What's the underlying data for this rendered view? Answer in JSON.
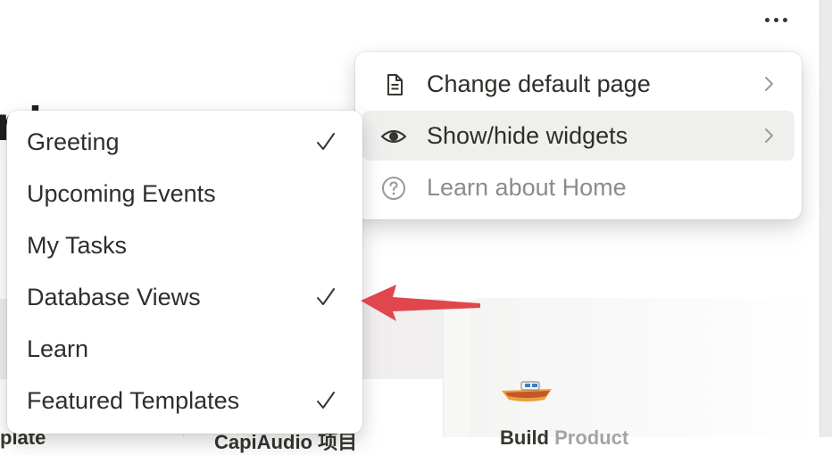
{
  "header": {
    "more_icon": "more-horizontal-icon"
  },
  "background": {
    "heading_fragment": "r             l",
    "card_texts": [
      "plate",
      "CapiAudio 项目",
      "Build ",
      "Product"
    ]
  },
  "home_menu": {
    "items": [
      {
        "label": "Change default page",
        "icon": "file-icon",
        "has_submenu": true
      },
      {
        "label": "Show/hide widgets",
        "icon": "eye-icon",
        "has_submenu": true,
        "highlighted": true
      },
      {
        "label": "Learn about Home",
        "icon": "help-circle-icon",
        "has_submenu": false
      }
    ]
  },
  "widgets_menu": {
    "items": [
      {
        "label": "Greeting",
        "checked": true
      },
      {
        "label": "Upcoming Events",
        "checked": false
      },
      {
        "label": "My Tasks",
        "checked": false
      },
      {
        "label": "Database Views",
        "checked": true
      },
      {
        "label": "Learn",
        "checked": false
      },
      {
        "label": "Featured Templates",
        "checked": true
      }
    ]
  },
  "annotation": {
    "arrow_color": "#e0474c",
    "points_to": "Database Views"
  },
  "colors": {
    "menu_bg": "#ffffff",
    "hover_bg": "#efefee",
    "text": "#2f2e2a",
    "muted_text": "#8d8c88"
  }
}
